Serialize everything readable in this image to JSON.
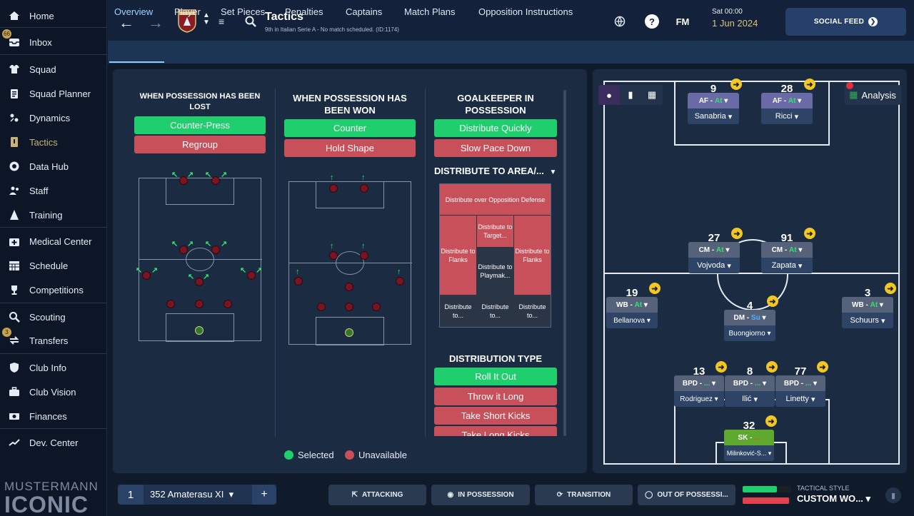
{
  "sidebar": {
    "items": [
      {
        "label": "Home",
        "icon": "home-icon"
      },
      {
        "label": "Inbox",
        "icon": "inbox-icon",
        "badge": "66"
      },
      {
        "label": "Squad",
        "icon": "shirt-icon"
      },
      {
        "label": "Squad Planner",
        "icon": "clipboard-icon"
      },
      {
        "label": "Dynamics",
        "icon": "dynamics-icon"
      },
      {
        "label": "Tactics",
        "icon": "tactics-icon"
      },
      {
        "label": "Data Hub",
        "icon": "data-hub-icon"
      },
      {
        "label": "Staff",
        "icon": "staff-icon"
      },
      {
        "label": "Training",
        "icon": "training-icon"
      },
      {
        "label": "Medical Center",
        "icon": "medical-icon"
      },
      {
        "label": "Schedule",
        "icon": "calendar-icon"
      },
      {
        "label": "Competitions",
        "icon": "trophy-icon"
      },
      {
        "label": "Scouting",
        "icon": "search-icon"
      },
      {
        "label": "Transfers",
        "icon": "transfers-icon",
        "badge": "3"
      },
      {
        "label": "Club Info",
        "icon": "shield-icon"
      },
      {
        "label": "Club Vision",
        "icon": "briefcase-icon"
      },
      {
        "label": "Finances",
        "icon": "money-icon"
      },
      {
        "label": "Dev. Center",
        "icon": "dev-icon"
      }
    ],
    "brand_top": "MUSTERMANN",
    "brand_big": "ICONIC"
  },
  "header": {
    "title": "Tactics",
    "subtitle": "9th in Italian Serie A - No match scheduled. (ID:1174)",
    "crest_text": "TORINO",
    "date_line1": "Sat 00:00",
    "date_line2": "1 Jun 2024",
    "fm_label": "FM",
    "social_label": "SOCIAL FEED"
  },
  "tabs": [
    "Overview",
    "Player",
    "Set Pieces",
    "Penalties",
    "Captains",
    "Match Plans",
    "Opposition Instructions"
  ],
  "columns": {
    "lost": {
      "title": "WHEN POSSESSION HAS BEEN LOST",
      "options": [
        "Counter-Press",
        "Regroup"
      ]
    },
    "won": {
      "title": "WHEN POSSESSION HAS BEEN WON",
      "options": [
        "Counter",
        "Hold Shape"
      ]
    },
    "gk": {
      "title": "GOALKEEPER IN POSSESSION",
      "options": [
        "Distribute Quickly",
        "Slow Pace Down"
      ]
    }
  },
  "distribute_area": {
    "label": "DISTRIBUTE TO AREA/...",
    "zones": [
      "Distribute over Opposition Defense",
      "Distribute to Target...",
      "Distribute to Flanks",
      "Distribute to Playmak...",
      "Distribute to Flanks",
      "Distribute to...",
      "Distribute to...",
      "Distribute to..."
    ]
  },
  "distribution_type": {
    "label": "DISTRIBUTION TYPE",
    "options": [
      "Roll It Out",
      "Throw it Long",
      "Take Short Kicks",
      "Take Long Kicks"
    ]
  },
  "legend": {
    "selected": "Selected",
    "unavailable": "Unavailable"
  },
  "analysis_label": "Analysis",
  "players": [
    {
      "num": "9",
      "role": "AF",
      "duty": "At",
      "name": "Sanabria"
    },
    {
      "num": "28",
      "role": "AF",
      "duty": "At",
      "name": "Ricci"
    },
    {
      "num": "27",
      "role": "CM",
      "duty": "At",
      "name": "Vojvoda"
    },
    {
      "num": "91",
      "role": "CM",
      "duty": "At",
      "name": "Zapata"
    },
    {
      "num": "19",
      "role": "WB",
      "duty": "At",
      "name": "Bellanova"
    },
    {
      "num": "4",
      "role": "DM",
      "duty": "Su",
      "name": "Buongiorno"
    },
    {
      "num": "3",
      "role": "WB",
      "duty": "At",
      "name": "Schuurs"
    },
    {
      "num": "13",
      "role": "BPD",
      "duty": "...",
      "name": "Rodriguez"
    },
    {
      "num": "8",
      "role": "BPD",
      "duty": "...",
      "name": "Ilić"
    },
    {
      "num": "77",
      "role": "BPD",
      "duty": "...",
      "name": "Linetty"
    },
    {
      "num": "32",
      "role": "SK",
      "duty": "...",
      "name": "Milinković-S..."
    }
  ],
  "bottom": {
    "tactic_num": "1",
    "tactic_name": "352 Amaterasu XI",
    "plus": "+",
    "phases": [
      "ATTACKING",
      "IN POSSESSION",
      "TRANSITION",
      "OUT OF POSSESSI..."
    ],
    "style_label": "TACTICAL STYLE",
    "style_value": "CUSTOM WO...",
    "bar_positive": 0.7,
    "bar_negative": 0.95
  },
  "colors": {
    "selected": "#1fcf6d",
    "unavailable": "#c7505a",
    "accent": "#8ec9ff"
  }
}
